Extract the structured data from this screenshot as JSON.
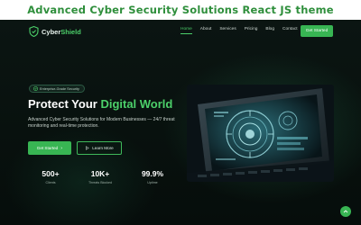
{
  "banner": {
    "title": "Advanced Cyber Security Solutions React JS theme"
  },
  "nav": {
    "logo": {
      "primary": "Cyber",
      "accent": "Shield"
    },
    "links": [
      {
        "label": "Home",
        "active": true
      },
      {
        "label": "About"
      },
      {
        "label": "Services"
      },
      {
        "label": "Pricing"
      },
      {
        "label": "Blog"
      },
      {
        "label": "Contact"
      }
    ],
    "cta": "Get Started"
  },
  "hero": {
    "badge": "Enterprise-Grade Security",
    "title_main": "Protect Your ",
    "title_accent": "Digital World",
    "description": "Advanced Cyber Security Solutions for Modern Businesses — 24/7 threat monitoring and real-time protection.",
    "primary_button": "Get Started",
    "secondary_button": "Learn More",
    "stats": [
      {
        "value": "500+",
        "label": "Clients"
      },
      {
        "value": "10K+",
        "label": "Threats Blocked"
      },
      {
        "value": "99.9%",
        "label": "Uptime"
      }
    ]
  },
  "icons": {
    "logo": "shield-icon",
    "badge": "shield-check-icon",
    "primary_arrow": "arrow-right-icon",
    "secondary": "play-icon",
    "scroll_top": "chevron-up-icon"
  },
  "colors": {
    "accent": "#4cd06a",
    "button": "#38b553",
    "background": "#0b1512",
    "banner_title": "#2f8f3c"
  }
}
